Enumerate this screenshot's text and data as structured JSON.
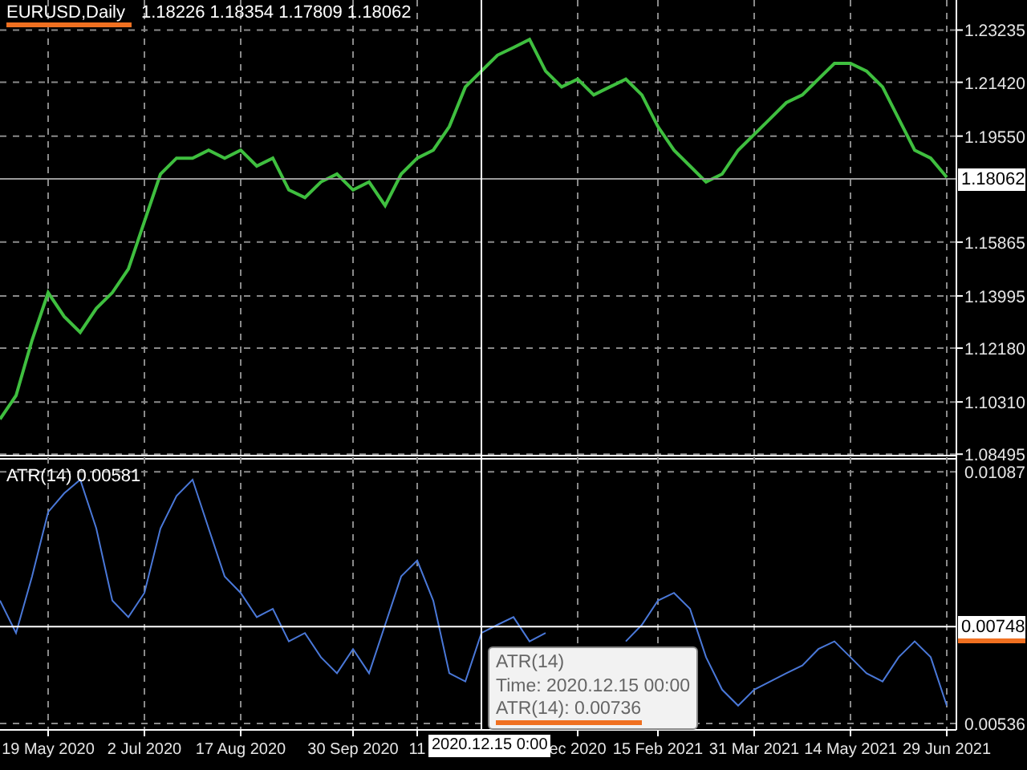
{
  "price_chart": {
    "symbol": {
      "text": "EURUSD,Daily",
      "underlined": true
    },
    "ohlc": "1.18226 1.18354 1.17809 1.18062",
    "chart_data": {
      "type": "line",
      "grid": true,
      "ylim": [
        1.0839,
        1.2428
      ],
      "categories": [
        null,
        null,
        null,
        null,
        null,
        null,
        null,
        null,
        null,
        null,
        null,
        null,
        null,
        null,
        null,
        null,
        null,
        null,
        null,
        null,
        null,
        null,
        null,
        null,
        null,
        null,
        null,
        null,
        null,
        null,
        null,
        null,
        null,
        null,
        null,
        null,
        null,
        null,
        null,
        null,
        null,
        null,
        null,
        null,
        null,
        null,
        null,
        null,
        null,
        null,
        null,
        null,
        null,
        null,
        null,
        null,
        null,
        null,
        null,
        null
      ],
      "yticks": [
        {
          "value": 1.23235,
          "label": "1.23235"
        },
        {
          "value": 1.2142,
          "label": "1.21420"
        },
        {
          "value": 1.1955,
          "label": "1.19550"
        },
        {
          "value": 1.15865,
          "label": "1.15865"
        },
        {
          "value": 1.13995,
          "label": "1.13995"
        },
        {
          "value": 1.1218,
          "label": "1.12180"
        },
        {
          "value": 1.1031,
          "label": "1.10310"
        },
        {
          "value": 1.08495,
          "label": "1.08495"
        }
      ],
      "series": [
        {
          "color": "#3fbf3f",
          "values": [
            1.0971,
            1.1053,
            1.1246,
            1.1411,
            1.1328,
            1.1273,
            1.1356,
            1.1411,
            1.1493,
            1.1658,
            1.1823,
            1.1878,
            1.1878,
            1.1906,
            1.1878,
            1.1906,
            1.1851,
            1.1878,
            1.1768,
            1.1741,
            1.1796,
            1.1823,
            1.1768,
            1.1796,
            1.1713,
            1.1823,
            1.1878,
            1.1906,
            1.1988,
            1.2126,
            1.2181,
            1.2236,
            1.2263,
            1.2291,
            1.2181,
            1.2126,
            1.2153,
            1.2098,
            1.2126,
            1.2153,
            1.2098,
            1.1988,
            1.1906,
            1.1851,
            1.1796,
            1.1823,
            1.1906,
            1.1961,
            1.2016,
            1.2071,
            1.2098,
            1.2153,
            1.2208,
            1.2208,
            1.2181,
            1.2126,
            1.2016,
            1.1906,
            1.1878,
            1.1812
          ]
        }
      ],
      "ref_lines": [
        {
          "axis": "y",
          "value": 1.18062,
          "label": "1.18062"
        }
      ]
    }
  },
  "indicator_chart": {
    "legend": "ATR(14) 0.00581",
    "value_label_underlined": true,
    "chart_data": {
      "type": "line",
      "grid": true,
      "ylim": [
        0.00522,
        0.01119
      ],
      "categories": [
        null,
        null,
        null,
        "19 May 2020",
        null,
        null,
        null,
        null,
        null,
        "2 Jul 2020",
        null,
        null,
        null,
        null,
        null,
        "17 Aug 2020",
        null,
        null,
        null,
        null,
        null,
        null,
        "30 Sep 2020",
        null,
        null,
        null,
        "11",
        null,
        null,
        null,
        null,
        null,
        null,
        null,
        null,
        null,
        "ec 2020",
        null,
        null,
        null,
        null,
        "15 Feb 2021",
        null,
        null,
        null,
        null,
        null,
        "31 Mar 2021",
        null,
        null,
        null,
        null,
        null,
        "14 May 2021",
        null,
        null,
        null,
        null,
        null,
        "29 Jun 2021"
      ],
      "yticks": [
        {
          "value": 0.01087,
          "label": "0.01087"
        },
        {
          "value": 0.00536,
          "label": "0.00536"
        }
      ],
      "series": [
        {
          "color": "#4a78d8",
          "values": [
            0.00805,
            0.00734,
            0.00858,
            0.00999,
            0.0104,
            0.0107,
            0.00963,
            0.00805,
            0.00769,
            0.00822,
            0.00963,
            0.01034,
            0.0107,
            0.00963,
            0.00858,
            0.00822,
            0.00769,
            0.00787,
            0.00716,
            0.00734,
            0.00681,
            0.00646,
            0.00699,
            0.00646,
            0.00752,
            0.00858,
            0.00893,
            0.00805,
            0.00646,
            0.00628,
            0.00734,
            0.00752,
            0.00769,
            0.00716,
            0.00734,
            null,
            null,
            null,
            null,
            0.00716,
            0.00752,
            0.00805,
            0.00822,
            0.00787,
            0.00681,
            0.0061,
            0.00575,
            0.0061,
            0.00628,
            0.00646,
            0.00663,
            0.00699,
            0.00716,
            0.00681,
            0.00646,
            0.00628,
            0.00681,
            0.00716,
            0.00681,
            0.00575
          ]
        }
      ],
      "ref_lines": [
        {
          "axis": "y",
          "value": 0.00748,
          "label": "0.00748"
        }
      ]
    }
  },
  "crosshair_time": "2020.12.15 0:00",
  "tooltip": {
    "lines": [
      {
        "text": "ATR(14)",
        "underlined": false
      },
      {
        "text": "Time: 2020.12.15 00:00",
        "underlined": false
      },
      {
        "text": "ATR(14): 0.00736",
        "underlined": true
      }
    ]
  }
}
